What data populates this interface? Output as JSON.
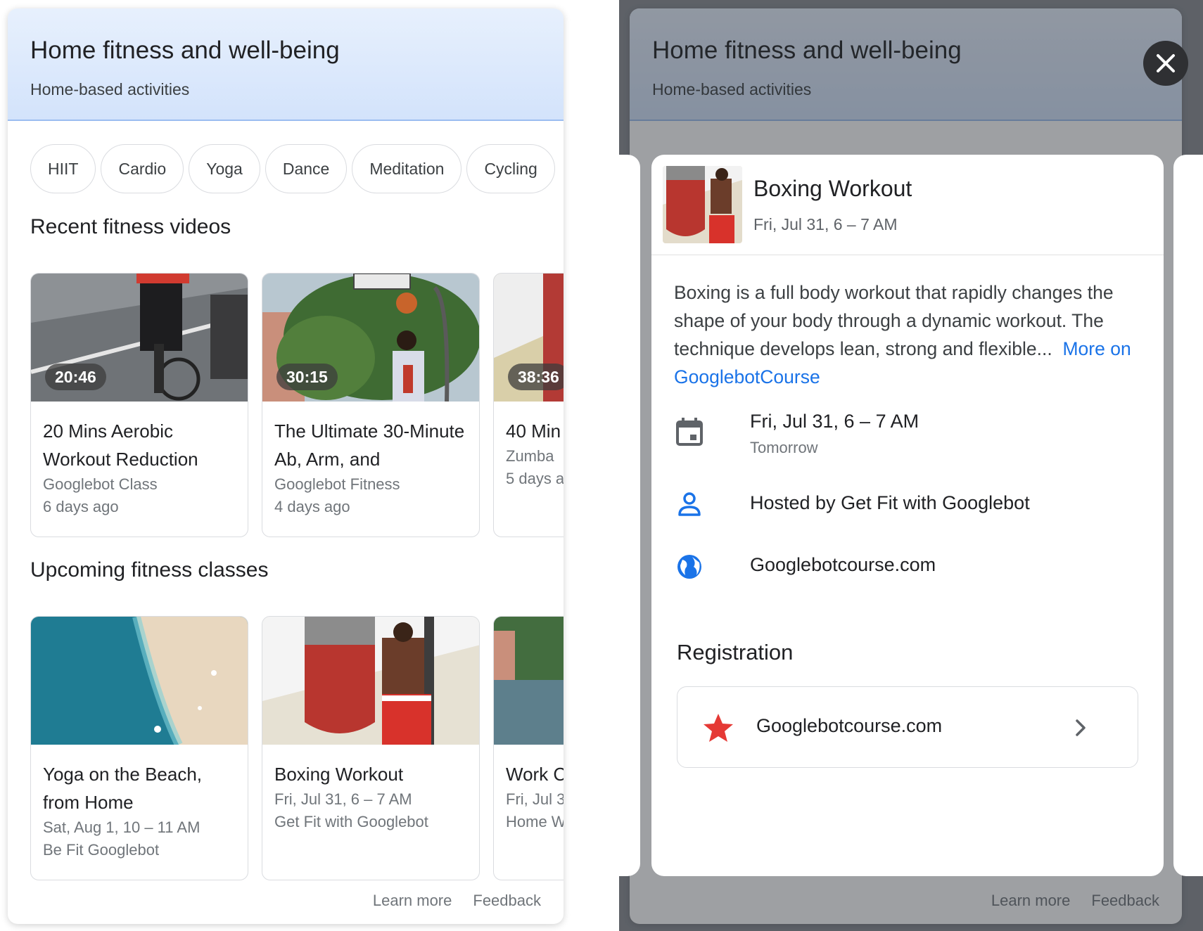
{
  "left": {
    "header": {
      "title": "Home fitness and well-being",
      "subtitle": "Home-based activities"
    },
    "chips": [
      "HIIT",
      "Cardio",
      "Yoga",
      "Dance",
      "Meditation",
      "Cycling"
    ],
    "recent": {
      "heading": "Recent fitness videos",
      "cards": [
        {
          "duration": "20:46",
          "title": "20 Mins Aerobic Workout Reduction",
          "channel": "Googlebot Class",
          "age": "6 days ago"
        },
        {
          "duration": "30:15",
          "title": "The Ultimate 30-Minute Ab, Arm, and",
          "channel": "Googlebot Fitness",
          "age": "4 days ago"
        },
        {
          "duration": "38:36",
          "title": "40 Min",
          "channel": "Zumba",
          "age": "5 days a"
        }
      ]
    },
    "upcoming": {
      "heading": "Upcoming fitness classes",
      "cards": [
        {
          "title": "Yoga on the Beach, from Home",
          "time": "Sat, Aug 1, 10 – 11 AM",
          "host": "Be Fit Googlebot"
        },
        {
          "title": "Boxing Workout",
          "time": "Fri, Jul 31, 6 – 7 AM",
          "host": "Get Fit with Googlebot"
        },
        {
          "title": "Work C Home",
          "time": "Fri, Jul 3",
          "host": "Home W"
        }
      ]
    },
    "footer": {
      "learn_more": "Learn more",
      "feedback": "Feedback"
    }
  },
  "right": {
    "header": {
      "title": "Home fitness and well-being",
      "subtitle": "Home-based activities"
    },
    "footer": {
      "learn_more": "Learn more",
      "feedback": "Feedback"
    },
    "sheet": {
      "title": "Boxing Workout",
      "date": "Fri, Jul 31, 6 – 7 AM",
      "description": "Boxing is a full body workout that rapidly changes the shape of your body through a dynamic workout. The technique develops lean, strong and flexible...",
      "more_link": "More on GooglebotCourse",
      "when": "Fri, Jul 31, 6 – 7 AM",
      "when_sub": "Tomorrow",
      "host": "Hosted by Get Fit with Googlebot",
      "website": "Googlebotcourse.com",
      "registration_heading": "Registration",
      "registration_link": "Googlebotcourse.com"
    }
  },
  "colors": {
    "link": "#1a73e8",
    "icon_blue": "#1a73e8",
    "star": "#e53935"
  },
  "icons": [
    "close-icon",
    "calendar-icon",
    "person-icon",
    "globe-icon",
    "star-icon",
    "chevron-right-icon"
  ]
}
